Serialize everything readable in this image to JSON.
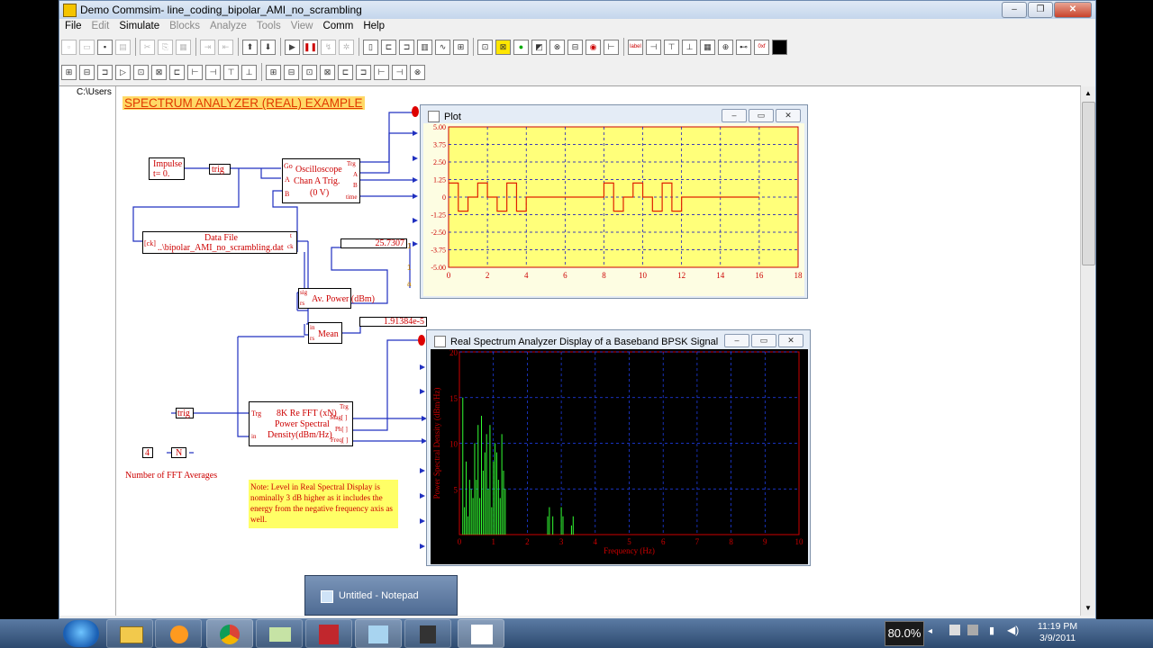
{
  "window": {
    "title": "Demo Commsim- line_coding_bipolar_AMI_no_scrambling"
  },
  "menu": [
    {
      "label": "File",
      "enabled": true
    },
    {
      "label": "Edit",
      "enabled": false
    },
    {
      "label": "Simulate",
      "enabled": true
    },
    {
      "label": "Blocks",
      "enabled": false
    },
    {
      "label": "Analyze",
      "enabled": false
    },
    {
      "label": "Tools",
      "enabled": false
    },
    {
      "label": "View",
      "enabled": false
    },
    {
      "label": "Comm",
      "enabled": true
    },
    {
      "label": "Help",
      "enabled": true
    }
  ],
  "tree": {
    "path": "C:\\Users"
  },
  "diagram": {
    "heading": "SPECTRUM ANALYZER (REAL) EXAMPLE",
    "impulse": {
      "line1": "Impulse",
      "line2": "t= 0."
    },
    "trig1": "trig",
    "trig2": "trig",
    "scope": {
      "go": "Go",
      "a": "A",
      "b": "B",
      "line1": "Oscilloscope",
      "line2": "Chan  A Trig.",
      "line3": "(0 V)",
      "out_trg": "Trg",
      "out_a": "A",
      "out_b": "B",
      "out_time": "time"
    },
    "datafile": {
      "ck": "[ck]",
      "line1": "Data File",
      "line2": "..\\bipolar_AMI_no_scrambling.dat",
      "ck_out": "ck",
      "t_out": "t"
    },
    "avpower": {
      "sig": "sig",
      "rs": "rs",
      "label": "Av. Power (dBm)"
    },
    "mean": {
      "in": "in",
      "rs": "rs",
      "label": "Mean"
    },
    "display1": "25.7307",
    "display2": "1.91384e-5",
    "fft": {
      "trg": "Trg",
      "in": "in",
      "line1": "8K Re FFT (xN)",
      "line2": "Power Spectral",
      "line3": "Density(dBm/Hz)",
      "o_trg": "Trg",
      "o_mag": "Mag[ ]",
      "o_ph": "Ph[ ]",
      "o_freq": "Freq[ ]"
    },
    "const4": "4",
    "constN": "N",
    "fft_caption": "Number of FFT Averages",
    "note": "Note:  Level in Real Spectral Display is nominally 3 dB higher as it includes the energy from the negative frequency axis as well."
  },
  "plot_window": {
    "title": "Plot"
  },
  "spectrum_window": {
    "title": "Real Spectrum Analyzer Display of a Baseband BPSK Signal"
  },
  "chart_data": [
    {
      "type": "line",
      "title": "",
      "xlabel": "",
      "ylabel": "",
      "xlim": [
        0,
        18
      ],
      "ylim": [
        -5.0,
        5.0
      ],
      "xticks": [
        "0",
        "2",
        "4",
        "6",
        "8",
        "10",
        "12",
        "14",
        "16",
        "18"
      ],
      "yticks": [
        "5.00",
        "3.75",
        "2.50",
        "1.25",
        "0",
        "-1.25",
        "-2.50",
        "-3.75",
        "-5.00"
      ],
      "grid": true,
      "series": [
        {
          "name": "",
          "x": [
            0,
            0.5,
            0.5,
            1,
            1,
            1.5,
            1.5,
            2,
            2,
            2.5,
            2.5,
            3,
            3,
            3.5,
            3.5,
            4,
            4,
            8,
            8,
            8.5,
            8.5,
            9,
            9,
            9.5,
            9.5,
            10,
            10,
            10.5,
            10.5,
            11,
            11,
            11.5,
            11.5,
            12,
            12,
            16
          ],
          "y": [
            1,
            1,
            -1,
            -1,
            0,
            0,
            1,
            1,
            0,
            0,
            -1,
            -1,
            1,
            1,
            -1,
            -1,
            0,
            0,
            1,
            1,
            -1,
            -1,
            0,
            0,
            1,
            1,
            0,
            0,
            -1,
            -1,
            1,
            1,
            -1,
            -1,
            0,
            0
          ]
        }
      ],
      "background": "#ffff7a",
      "line_color": "#e02000"
    },
    {
      "type": "line",
      "title": "",
      "xlabel": "Frequency (Hz)",
      "ylabel": "Power Spectral Density (dBm/Hz)",
      "xlim": [
        0,
        10
      ],
      "ylim": [
        0,
        20
      ],
      "xticks": [
        "0",
        "1",
        "2",
        "3",
        "4",
        "5",
        "6",
        "7",
        "8",
        "9",
        "10"
      ],
      "yticks": [
        "20",
        "15",
        "10",
        "5"
      ],
      "grid": true,
      "series": [
        {
          "name": "",
          "x": [
            0.1,
            0.15,
            0.2,
            0.25,
            0.3,
            0.35,
            0.4,
            0.45,
            0.5,
            0.55,
            0.6,
            0.65,
            0.7,
            0.75,
            0.8,
            0.85,
            0.9,
            0.95,
            1.0,
            1.05,
            1.1,
            1.15,
            1.2,
            1.25,
            1.3,
            1.35,
            2.6,
            2.65,
            2.75,
            3.0,
            3.05,
            3.3,
            3.35
          ],
          "y": [
            15,
            3,
            8,
            2,
            6,
            5,
            4,
            10,
            6,
            12,
            4,
            13,
            7,
            9,
            11,
            5,
            12,
            3,
            8,
            10,
            9,
            6,
            4,
            11,
            7,
            5,
            2,
            3,
            2,
            3,
            2,
            1,
            2
          ]
        }
      ],
      "background": "#000000",
      "line_color": "#33ff33"
    }
  ],
  "notepad": {
    "label": "Untitled - Notepad"
  },
  "tray": {
    "zoom": "80.0%",
    "time": "11:19 PM",
    "date": "3/9/2011"
  }
}
